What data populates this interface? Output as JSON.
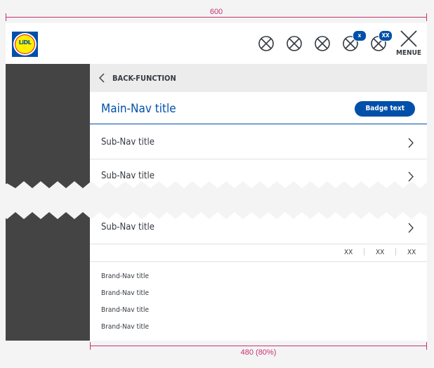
{
  "dimensions": {
    "total_width_label": "600",
    "panel_width_label": "480 (80%)"
  },
  "header": {
    "logo_text": "LiDL",
    "icons": [
      {
        "name": "placeholder-icon-1"
      },
      {
        "name": "placeholder-icon-2"
      },
      {
        "name": "placeholder-icon-3"
      },
      {
        "name": "placeholder-icon-4",
        "badge": "x"
      },
      {
        "name": "placeholder-icon-5",
        "badge": "XX"
      }
    ],
    "menu_label": "MENUE"
  },
  "panel": {
    "back_label": "BACK-FUNCTION",
    "main_title": "Main-Nav title",
    "badge_text": "Badge text",
    "subnav": [
      "Sub-Nav title",
      "Sub-Nav title",
      "Sub-Nav title"
    ],
    "xx_items": [
      "XX",
      "XX",
      "XX"
    ],
    "brand_nav": [
      "Brand-Nav title",
      "Brand-Nav title",
      "Brand-Nav title",
      "Brand-Nav title"
    ]
  },
  "colors": {
    "brand_blue": "#0050aa",
    "dimension_pink": "#c8336e",
    "overlay": "#444444",
    "text": "#353b42"
  }
}
